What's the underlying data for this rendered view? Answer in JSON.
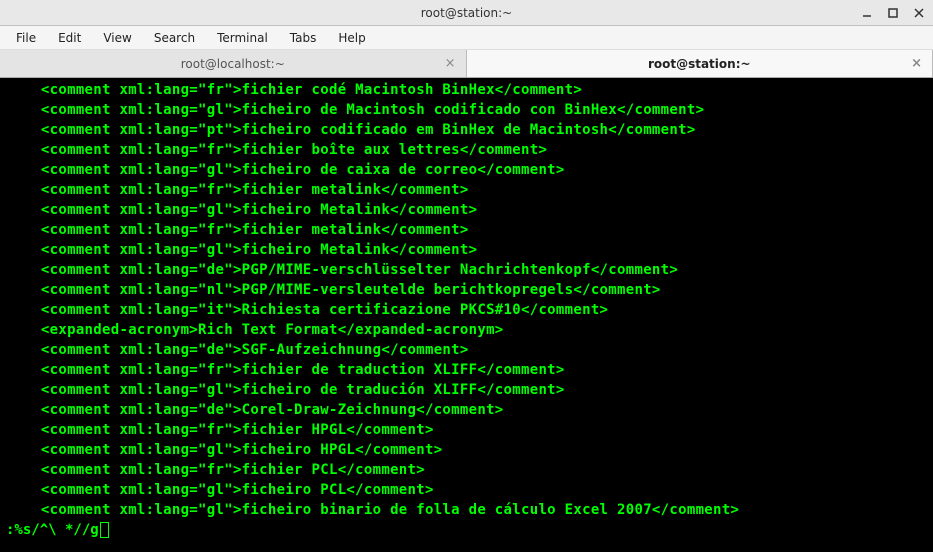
{
  "window": {
    "title": "root@station:~"
  },
  "menubar": {
    "file": "File",
    "edit": "Edit",
    "view": "View",
    "search": "Search",
    "terminal": "Terminal",
    "tabs": "Tabs",
    "help": "Help"
  },
  "tabs": [
    {
      "label": "root@localhost:~",
      "active": false
    },
    {
      "label": "root@station:~",
      "active": true
    }
  ],
  "terminal_lines": [
    "    <comment xml:lang=\"fr\">fichier codé Macintosh BinHex</comment>",
    "    <comment xml:lang=\"gl\">ficheiro de Macintosh codificado con BinHex</comment>",
    "    <comment xml:lang=\"pt\">ficheiro codificado em BinHex de Macintosh</comment>",
    "    <comment xml:lang=\"fr\">fichier boîte aux lettres</comment>",
    "    <comment xml:lang=\"gl\">ficheiro de caixa de correo</comment>",
    "    <comment xml:lang=\"fr\">fichier metalink</comment>",
    "    <comment xml:lang=\"gl\">ficheiro Metalink</comment>",
    "    <comment xml:lang=\"fr\">fichier metalink</comment>",
    "    <comment xml:lang=\"gl\">ficheiro Metalink</comment>",
    "    <comment xml:lang=\"de\">PGP/MIME-verschlüsselter Nachrichtenkopf</comment>",
    "    <comment xml:lang=\"nl\">PGP/MIME-versleutelde berichtkopregels</comment>",
    "    <comment xml:lang=\"it\">Richiesta certificazione PKCS#10</comment>",
    "    <expanded-acronym>Rich Text Format</expanded-acronym>",
    "    <comment xml:lang=\"de\">SGF-Aufzeichnung</comment>",
    "    <comment xml:lang=\"fr\">fichier de traduction XLIFF</comment>",
    "    <comment xml:lang=\"gl\">ficheiro de tradución XLIFF</comment>",
    "    <comment xml:lang=\"de\">Corel-Draw-Zeichnung</comment>",
    "    <comment xml:lang=\"fr\">fichier HPGL</comment>",
    "    <comment xml:lang=\"gl\">ficheiro HPGL</comment>",
    "    <comment xml:lang=\"fr\">fichier PCL</comment>",
    "    <comment xml:lang=\"gl\">ficheiro PCL</comment>",
    "    <comment xml:lang=\"gl\">ficheiro binario de folla de cálculo Excel 2007</comment>"
  ],
  "command_line": ":%s/^\\ *//g"
}
